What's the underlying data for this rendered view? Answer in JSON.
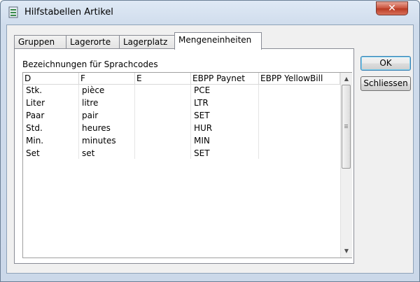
{
  "window": {
    "title": "Hilfstabellen Artikel",
    "close_glyph": "✕",
    "icon": "table-icon"
  },
  "tabs": [
    {
      "label": "Gruppen",
      "active": false
    },
    {
      "label": "Lagerorte",
      "active": false
    },
    {
      "label": "Lagerplatz",
      "active": false
    },
    {
      "label": "Mengeneinheiten",
      "active": true
    }
  ],
  "panel": {
    "group_label": "Bezeichnungen für Sprachcodes"
  },
  "grid": {
    "columns": [
      "D",
      "F",
      "E",
      "EBPP Paynet",
      "EBPP YellowBill"
    ],
    "rows": [
      [
        "Stk.",
        "pièce",
        "",
        "PCE",
        ""
      ],
      [
        "Liter",
        "litre",
        "",
        "LTR",
        ""
      ],
      [
        "Paar",
        "pair",
        "",
        "SET",
        ""
      ],
      [
        "Std.",
        "heures",
        "",
        "HUR",
        ""
      ],
      [
        "Min.",
        "minutes",
        "",
        "MIN",
        ""
      ],
      [
        "Set",
        "set",
        "",
        "SET",
        ""
      ]
    ]
  },
  "buttons": {
    "ok": "OK",
    "close": "Schliessen"
  }
}
